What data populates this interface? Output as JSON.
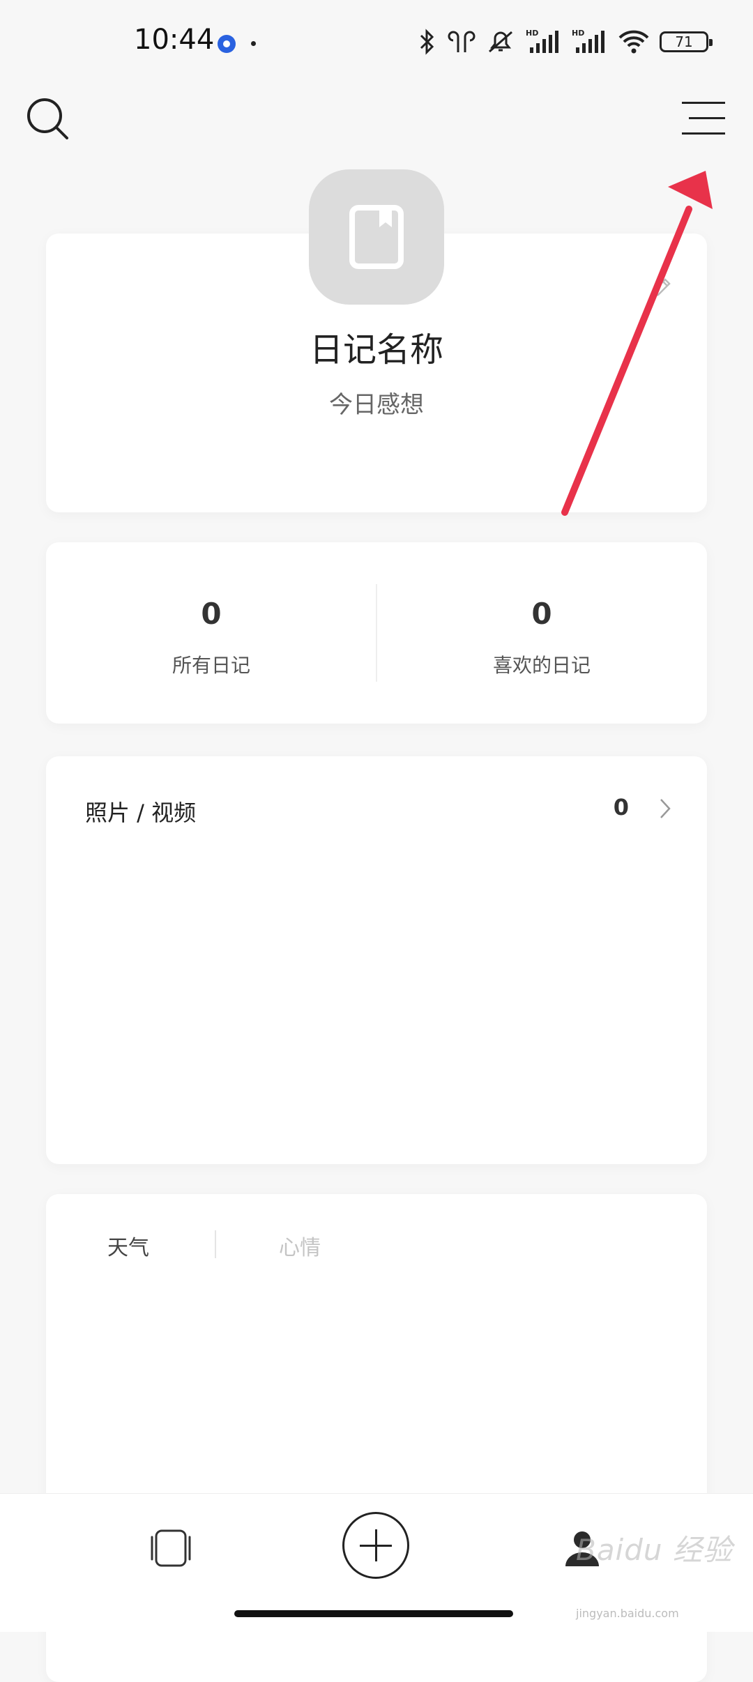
{
  "status_bar": {
    "time": "10:44",
    "battery": "71",
    "icons": [
      "bluetooth-icon",
      "earbuds-icon",
      "silent-icon",
      "signal-hd-icon",
      "signal-hd-icon",
      "wifi-icon",
      "battery-icon"
    ]
  },
  "header": {
    "search_icon": "search-icon",
    "menu_icon": "menu-icon"
  },
  "profile": {
    "name": "日记名称",
    "subtitle": "今日感想",
    "edit_icon": "pencil-icon"
  },
  "stats": [
    {
      "value": "0",
      "label": "所有日记"
    },
    {
      "value": "0",
      "label": "喜欢的日记"
    }
  ],
  "media": {
    "title": "照片 / 视频",
    "count": "0"
  },
  "mood": {
    "tabs": [
      {
        "label": "天气",
        "active": true
      },
      {
        "label": "心情",
        "active": false
      }
    ]
  },
  "bottom_nav": {
    "items": [
      "cards-icon",
      "add-icon",
      "profile-icon"
    ]
  },
  "watermark": {
    "text": "Baidu 经验",
    "sub": "jingyan.baidu.com"
  },
  "colors": {
    "background": "#f7f7f7",
    "card": "#ffffff",
    "avatar": "#dcdcdc",
    "annotation_arrow": "#e8324a"
  }
}
